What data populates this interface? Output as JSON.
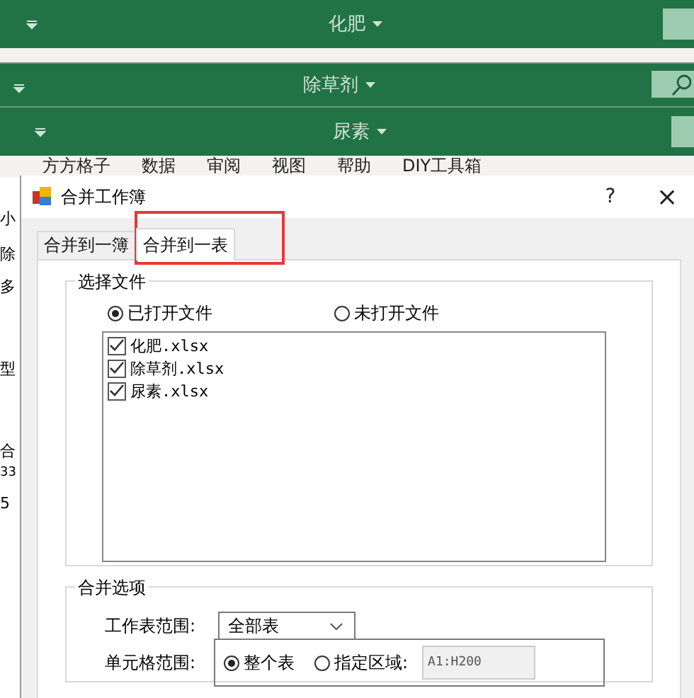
{
  "windows": [
    {
      "title": "化肥"
    },
    {
      "title": "除草剂"
    },
    {
      "title": "尿素"
    }
  ],
  "ribbon_tabs": [
    "方方格子",
    "数据",
    "审阅",
    "视图",
    "帮助",
    "DIY工具箱"
  ],
  "sheet_fragments": [
    "小",
    "除",
    "多",
    "型",
    "合",
    "33",
    "5"
  ],
  "dialog": {
    "title": "合并工作簿",
    "help": "?",
    "close": "×",
    "tabs": [
      {
        "label": "合并到一簿",
        "selected": false,
        "highlighted": false
      },
      {
        "label": "合并到一表",
        "selected": true,
        "highlighted": true
      }
    ],
    "file_group": {
      "title": "选择文件",
      "sources": [
        {
          "label": "已打开文件",
          "selected": true
        },
        {
          "label": "未打开文件",
          "selected": false
        }
      ],
      "files": [
        {
          "name": "化肥.xlsx",
          "checked": true
        },
        {
          "name": "除草剂.xlsx",
          "checked": true
        },
        {
          "name": "尿素.xlsx",
          "checked": true
        }
      ]
    },
    "options_group": {
      "title": "合并选项",
      "sheet_range_label": "工作表范围:",
      "sheet_range": "全部表",
      "cell_range_label": "单元格范围:",
      "cell_ranges": [
        {
          "label": "整个表",
          "selected": true
        },
        {
          "label": "指定区域:",
          "selected": false
        }
      ],
      "range_value": "A1:H200"
    }
  }
}
